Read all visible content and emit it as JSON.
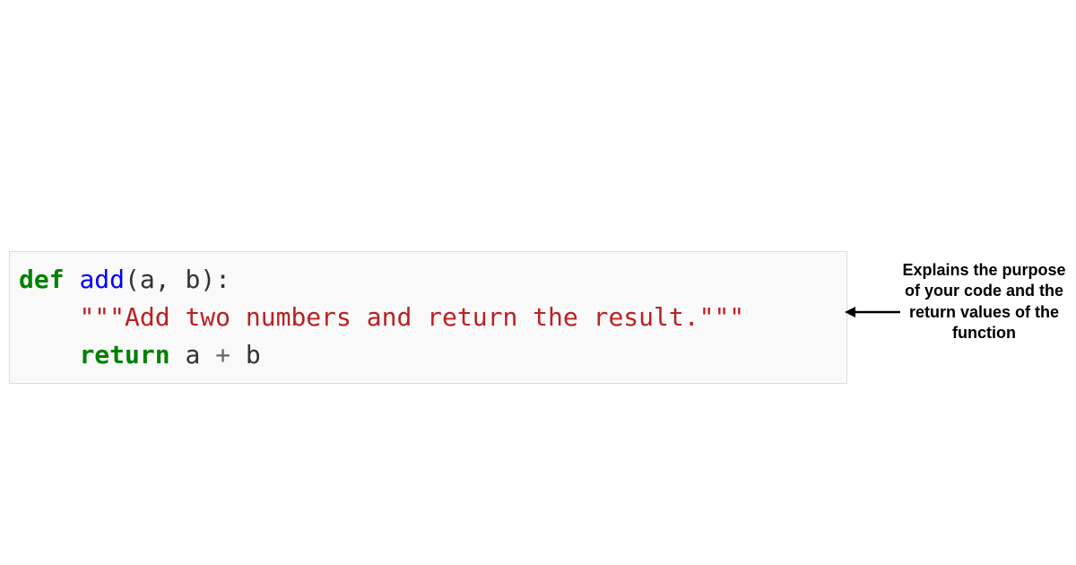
{
  "code": {
    "def": "def",
    "space1": " ",
    "fn": "add",
    "open_paren": "(",
    "param_a": "a",
    "comma": ", ",
    "param_b": "b",
    "close_paren": ")",
    "colon": ":",
    "indent": "    ",
    "docstring": "\"\"\"Add two numbers and return the result.\"\"\"",
    "return_kw": "return",
    "space2": " ",
    "ret_a": "a",
    "plus": " + ",
    "ret_b": "b"
  },
  "annotation": {
    "text": "Explains the purpose of your code and the return values of the function"
  }
}
